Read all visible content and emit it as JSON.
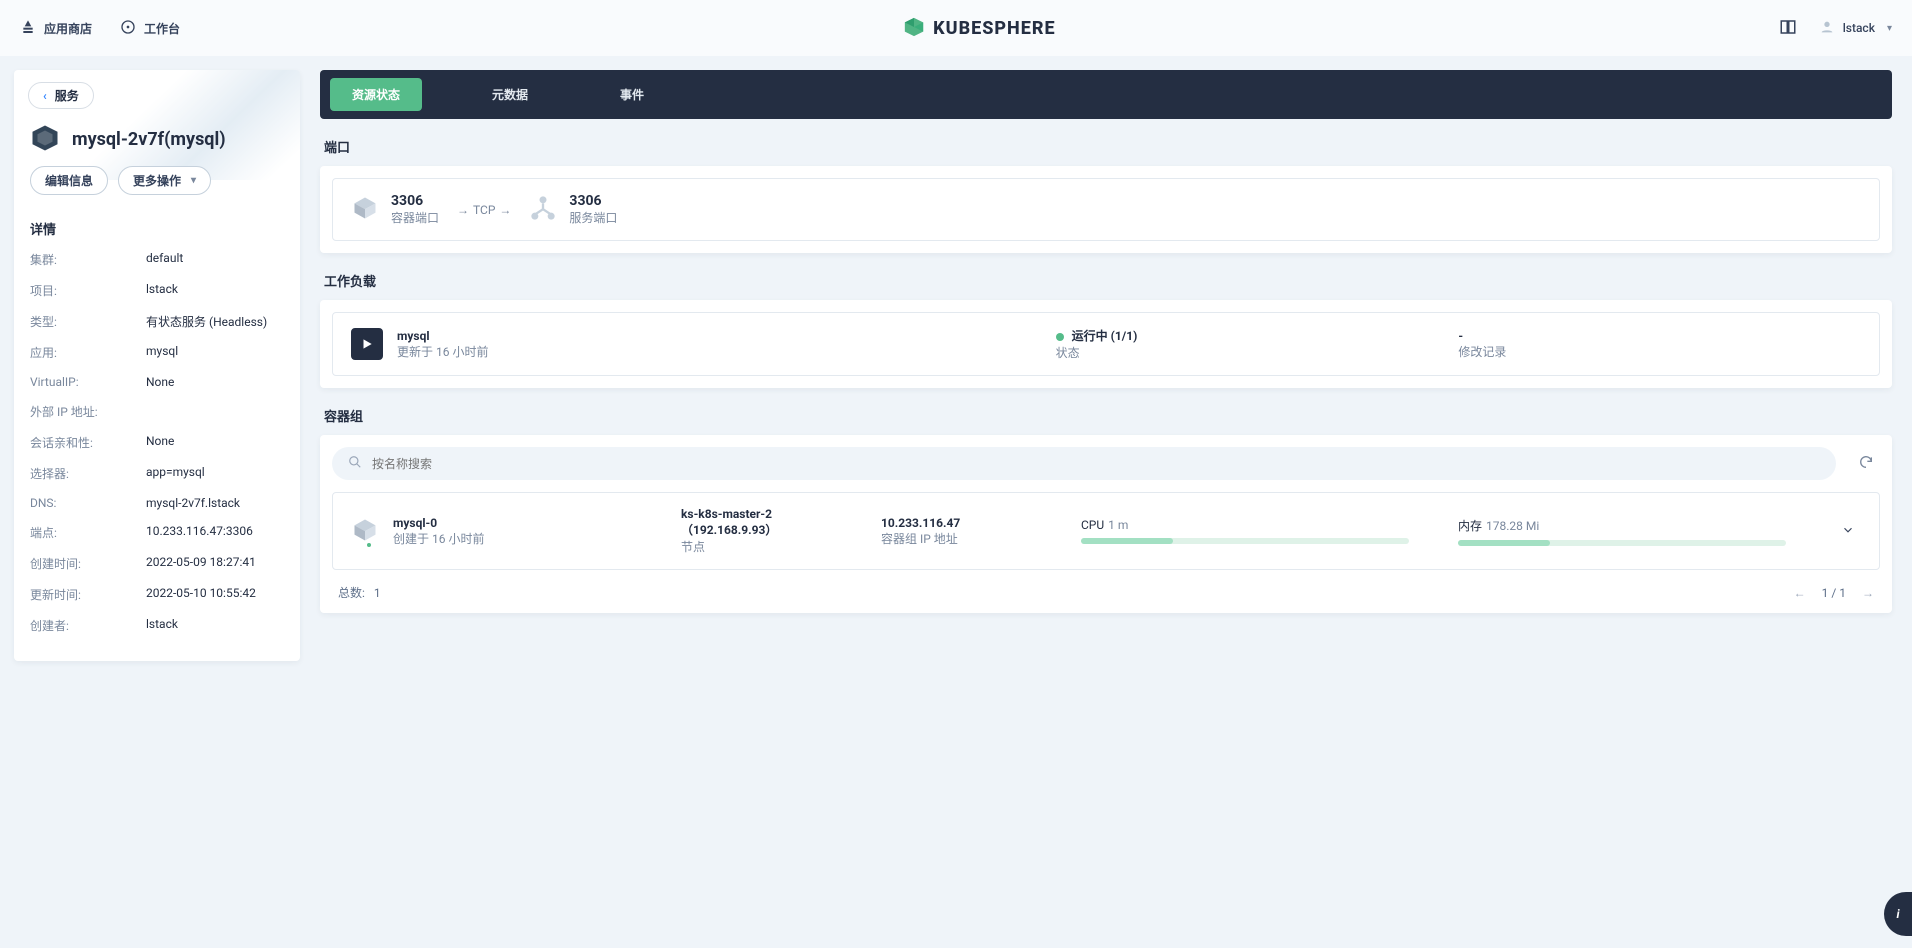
{
  "topbar": {
    "appstore": "应用商店",
    "workbench": "工作台",
    "brand": "KUBESPHERE",
    "user": "lstack"
  },
  "sidebar": {
    "back_label": "服务",
    "title": "mysql-2v7f(mysql)",
    "edit_btn": "编辑信息",
    "more_btn": "更多操作",
    "details_header": "详情",
    "fields": [
      {
        "k": "集群:",
        "v": "default"
      },
      {
        "k": "项目:",
        "v": "lstack"
      },
      {
        "k": "类型:",
        "v": "有状态服务 (Headless)"
      },
      {
        "k": "应用:",
        "v": "mysql"
      },
      {
        "k": "VirtualIP:",
        "v": "None"
      },
      {
        "k": "外部 IP 地址:",
        "v": ""
      },
      {
        "k": "会话亲和性:",
        "v": "None"
      },
      {
        "k": "选择器:",
        "v": "app=mysql"
      },
      {
        "k": "DNS:",
        "v": "mysql-2v7f.lstack"
      },
      {
        "k": "端点:",
        "v": "10.233.116.47:3306"
      },
      {
        "k": "创建时间:",
        "v": "2022-05-09 18:27:41"
      },
      {
        "k": "更新时间:",
        "v": "2022-05-10 10:55:42"
      },
      {
        "k": "创建者:",
        "v": "lstack"
      }
    ]
  },
  "tabs": {
    "resource": "资源状态",
    "metadata": "元数据",
    "events": "事件"
  },
  "ports": {
    "header": "端口",
    "container_port": "3306",
    "container_port_label": "容器端口",
    "protocol": "TCP",
    "service_port": "3306",
    "service_port_label": "服务端口"
  },
  "workloads": {
    "header": "工作负载",
    "name": "mysql",
    "updated": "更新于 16 小时前",
    "status": "运行中 (1/1)",
    "status_label": "状态",
    "revision_value": "-",
    "revision_label": "修改记录"
  },
  "pods": {
    "header": "容器组",
    "search_placeholder": "按名称搜索",
    "item": {
      "name": "mysql-0",
      "created": "创建于 16 小时前",
      "node": "ks-k8s-master-2（192.168.9.93）",
      "node_label": "节点",
      "ip": "10.233.116.47",
      "ip_label": "容器组 IP 地址",
      "cpu_label": "CPU",
      "cpu_val": "1 m",
      "mem_label": "内存",
      "mem_val": "178.28 Mi"
    },
    "total_label": "总数:",
    "total_value": "1",
    "page": "1 / 1"
  }
}
